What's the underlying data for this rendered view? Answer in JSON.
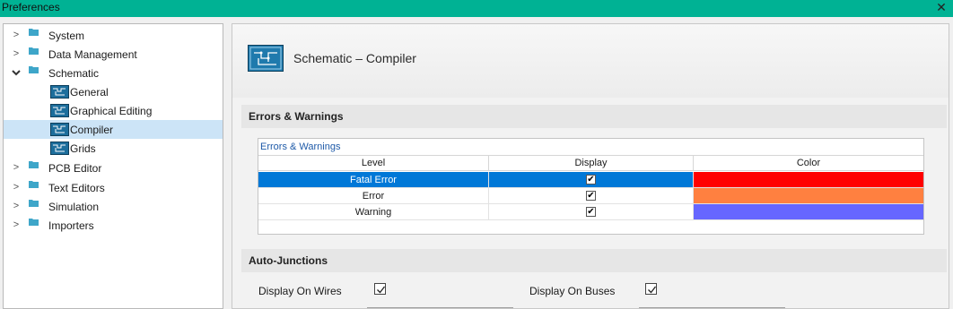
{
  "window": {
    "title": "Preferences"
  },
  "tree": {
    "items": [
      {
        "label": "System",
        "expanded": false
      },
      {
        "label": "Data Management",
        "expanded": false
      },
      {
        "label": "Schematic",
        "expanded": true
      },
      {
        "label": "General"
      },
      {
        "label": "Graphical Editing"
      },
      {
        "label": "Compiler",
        "selected": true
      },
      {
        "label": "Grids"
      },
      {
        "label": "PCB Editor",
        "expanded": false
      },
      {
        "label": "Text Editors",
        "expanded": false
      },
      {
        "label": "Simulation",
        "expanded": false
      },
      {
        "label": "Importers",
        "expanded": false
      }
    ]
  },
  "header": {
    "title": "Schematic – Compiler",
    "icon": "schematic-icon"
  },
  "errors_section": {
    "title": "Errors & Warnings",
    "grid_caption": "Errors & Warnings",
    "columns": [
      "Level",
      "Display",
      "Color"
    ],
    "rows": [
      {
        "level": "Fatal Error",
        "display": true,
        "color": "#ff0000"
      },
      {
        "level": "Error",
        "display": true,
        "color": "#ff8040"
      },
      {
        "level": "Warning",
        "display": true,
        "color": "#6666ff"
      }
    ]
  },
  "junctions_section": {
    "title": "Auto-Junctions",
    "display_on_wires_label": "Display On Wires",
    "display_on_wires": true,
    "display_on_buses_label": "Display On Buses",
    "display_on_buses": true
  },
  "colors": {
    "titlebar": "#00b294",
    "selection": "#0078d7",
    "tree_selection": "#cce4f7"
  }
}
